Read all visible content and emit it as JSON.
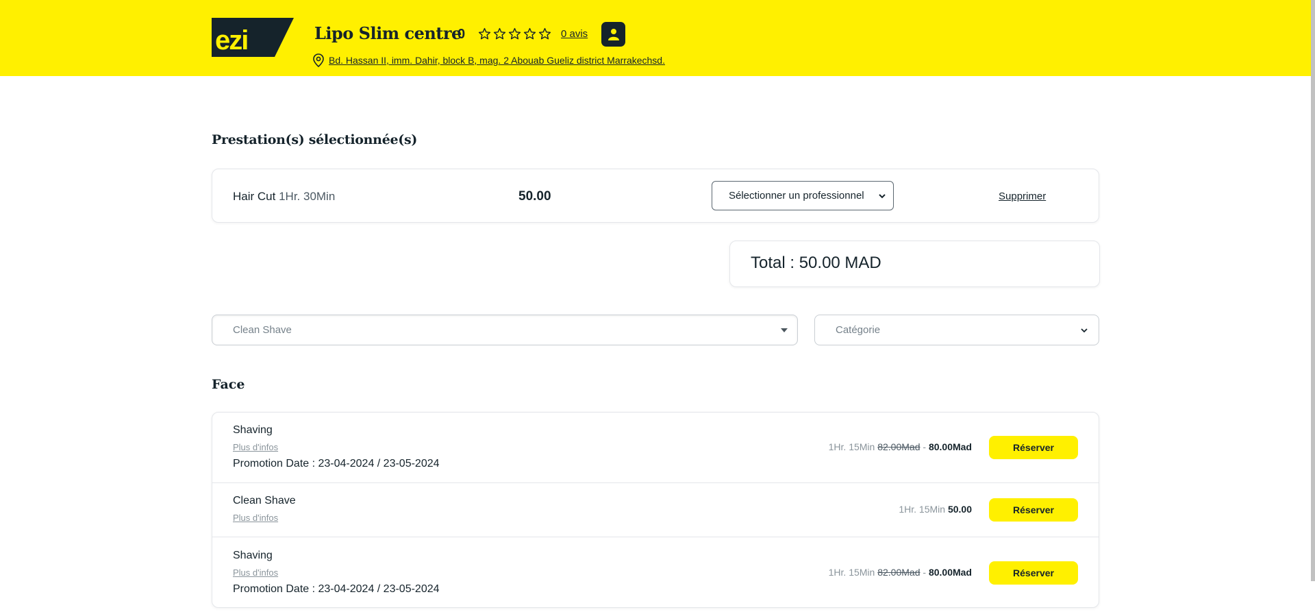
{
  "header": {
    "logo_text": "ezi",
    "business_name": "Lipo Slim centre",
    "rating_value": "0",
    "stars_filled": 0,
    "stars_total": 5,
    "reviews_link": "0 avis",
    "address": " Bd. Hassan II, imm. Dahir, block B, mag. 2 Abouab Gueliz district Marrakechsd.",
    "icons": {
      "user": "user-icon",
      "pin": "location-pin-icon",
      "star": "star-outline-icon"
    },
    "colors": {
      "brand_yellow": "#fff000",
      "dark": "#15232b"
    }
  },
  "selected": {
    "title": "Prestation(s) sélectionnée(s)",
    "item": {
      "name": "Hair Cut",
      "duration": " 1Hr. 30Min",
      "price": "50.00",
      "professional_select": "Sélectionner un professionnel",
      "delete_label": "Supprimer"
    },
    "total": "Total : 50.00 MAD"
  },
  "filters": {
    "service_value": "Clean Shave",
    "category_placeholder": "Catégorie"
  },
  "group": {
    "title": "Face",
    "services": [
      {
        "name": "Shaving",
        "info_link": "Plus d'infos",
        "promo": "Promotion Date : 23-04-2024 / 23-05-2024",
        "duration": "1Hr. 15Min ",
        "old_price": "82.00Mad",
        "separator": " - ",
        "price": "80.00Mad",
        "button": "Réserver"
      },
      {
        "name": "Clean Shave",
        "info_link": "Plus d'infos",
        "duration": "1Hr. 15Min ",
        "price": "50.00",
        "button": "Réserver"
      },
      {
        "name": "Shaving",
        "info_link": "Plus d'infos",
        "promo": "Promotion Date : 23-04-2024 / 23-05-2024",
        "duration": "1Hr. 15Min ",
        "old_price": "82.00Mad",
        "separator": " - ",
        "price": "80.00Mad",
        "button": "Réserver"
      }
    ]
  }
}
